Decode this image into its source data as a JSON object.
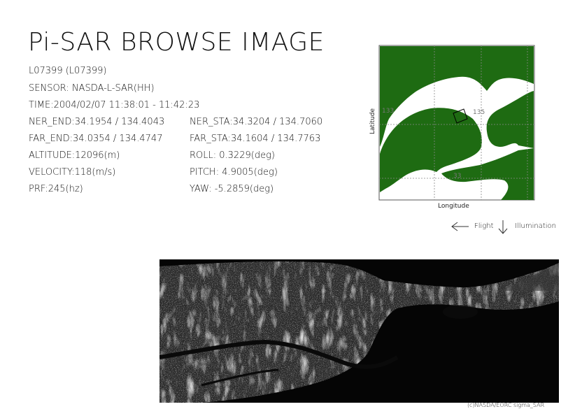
{
  "header": {
    "title": "Pi-SAR BROWSE IMAGE"
  },
  "info": {
    "scene_id": "L07399 (L07399)",
    "sensor": "SENSOR: NASDA-L-SAR(HH)",
    "time": "TIME:2004/02/07  11:38:01 - 11:42:23",
    "ner_end": "NER_END:34.1954 / 134.4043",
    "ner_sta": "NER_STA:34.3204 / 134.7060",
    "far_end": "FAR_END:34.0354 / 134.4747",
    "far_sta": "FAR_STA:34.1604 / 134.7763",
    "altitude": "ALTITUDE:12096(m)",
    "roll": "ROLL: 0.3229(deg)",
    "velocity": "VELOCITY:118(m/s)",
    "pitch": "PITCH:  4.9005(deg)",
    "prf": "PRF:245(hz)",
    "yaw": "YAW:  -5.2859(deg)"
  },
  "map": {
    "xlabel": "Longitude",
    "ylabel": "Latitude",
    "lon_tick_1": "133",
    "lon_tick_2": "135",
    "lat_tick": "33",
    "land_color": "#1e6b12",
    "sea_color": "#ffffff"
  },
  "legend": {
    "flight_label": "Flight",
    "illumination_label": "Illumination",
    "flight_icon": "arrow-left-icon",
    "illumination_icon": "arrow-down-icon"
  },
  "footer": {
    "credit": "(c)NASDA/EORC sigma_SAR"
  }
}
